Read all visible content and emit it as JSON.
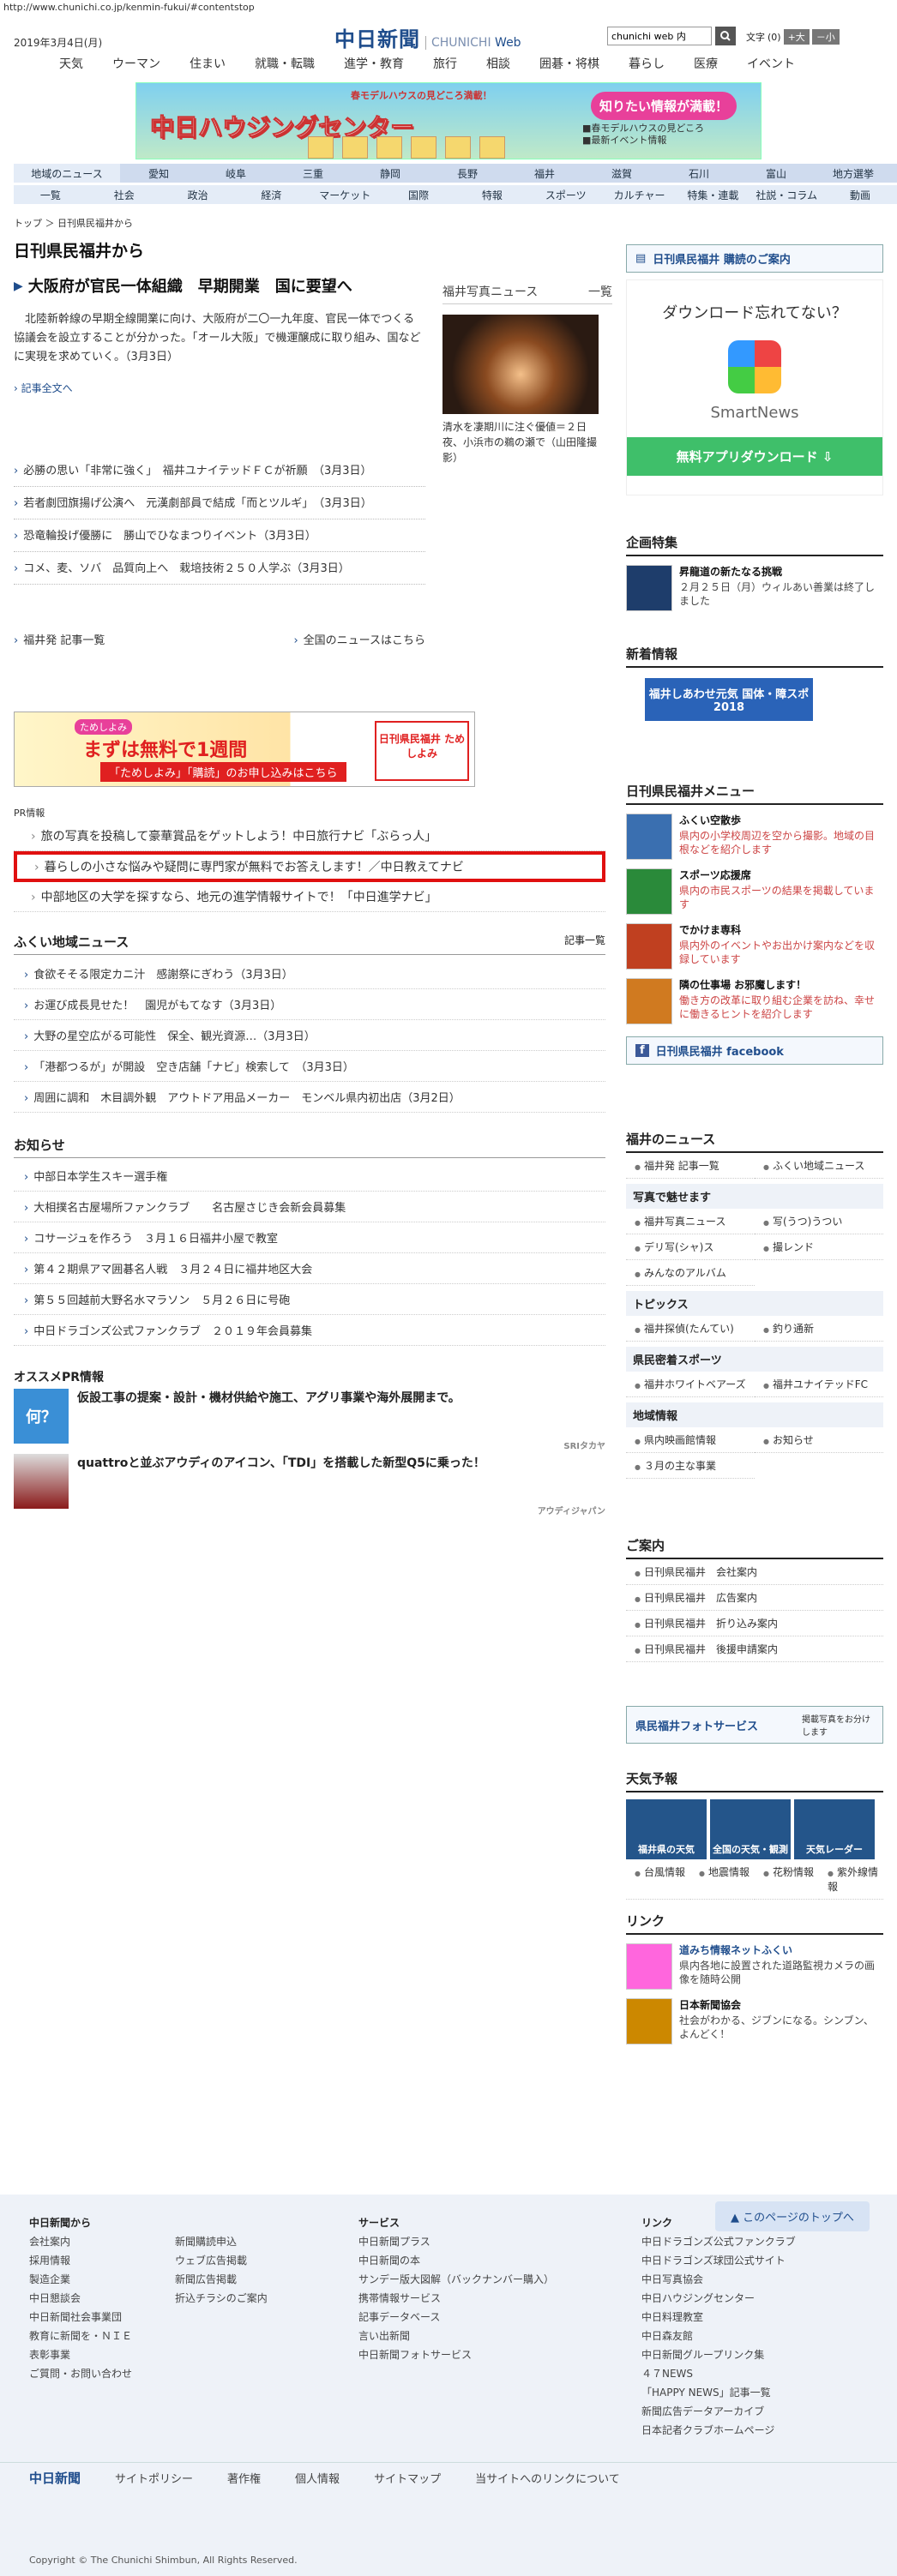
{
  "url": "http://www.chunichi.co.jp/kenmin-fukui/#contentstop",
  "date": "2019年3月4日(月)",
  "logo": {
    "ja": "中日新聞",
    "en1": "CHUNICHI",
    "en2": "Web"
  },
  "search": {
    "value": "chunichi web 内"
  },
  "font": {
    "label": "文字",
    "size": "(0)",
    "plus": "+大",
    "minus": "－小"
  },
  "gnav": [
    "天気",
    "ウーマン",
    "住まい",
    "就職・転職",
    "進学・教育",
    "旅行",
    "相談",
    "囲碁・将棋",
    "暮らし",
    "医療",
    "イベント"
  ],
  "banner": {
    "t1": "春モデルハウスの見どころ満載！",
    "t2": "中日ハウジングセンター",
    "t3": "知りたい情報が満載！",
    "t4": "■春モデルハウスの見どころ\n■最新イベント情報"
  },
  "area": [
    "地域のニュース",
    "愛知",
    "岐阜",
    "三重",
    "静岡",
    "長野",
    "福井",
    "滋賀",
    "石川",
    "富山",
    "地方選挙"
  ],
  "cats": [
    "一覧",
    "社会",
    "政治",
    "経済",
    "マーケット",
    "国際",
    "特報",
    "スポーツ",
    "カルチャー",
    "特集・連載",
    "社説・コラム",
    "動画"
  ],
  "breadcrumb": "トップ ＞ 日刊県民福井から",
  "page_title": "日刊県民福井から",
  "lead": {
    "headline": "大阪府が官民一体組織　早期開業　国に要望へ",
    "body": "北陸新幹線の早期全線開業に向け、大阪府が二〇一九年度、官民一体でつくる協議会を設立することが分かった。「オール大阪」で機運醸成に取り組み、国などに実現を求めていく。（3月3日）",
    "more": "記事全文へ"
  },
  "photo": {
    "head": "福井写真ニュース",
    "list": "一覧",
    "caption": "清水を凄期川に注ぐ優値＝２日夜、小浜市の鵜の瀬で（山田隆撮影）"
  },
  "news": [
    "必勝の思い「非常に強く」　福井ユナイテッドＦＣが祈願　（3月3日）",
    "若者劇団旗揚げ公演へ　元漢劇部員で結成「而とツルギ」　（3月3日）",
    "恐竜輪投げ優勝に　勝山でひなまつりイベント（3月3日）",
    "コメ、麦、ソバ　品質向上へ　栽培技術２５０人学ぶ（3月3日）"
  ],
  "foot": {
    "left": "福井発 記事一覧",
    "right": "全国のニュースはこちら"
  },
  "promo": {
    "a": "ためしよみ",
    "b": "まずは無料で1週間",
    "c": "「ためしよみ」「購読」のお申し込みはこちら",
    "d": "日刊県民福井 ためしよみ"
  },
  "pr": {
    "head": "PR情報",
    "items": [
      "旅の写真を投稿して豪華賞品をゲットしよう！中日旅行ナビ「ぶらっ人」",
      "暮らしの小さな悩みや疑問に専門家が無料でお答えします！／中日教えてナビ",
      "中部地区の大学を探すなら、地元の進学情報サイトで！「中日進学ナビ」"
    ]
  },
  "fukui": {
    "head": "ふくい地域ニュース",
    "more": "記事一覧",
    "items": [
      "食欲そそる限定カニ汁　感謝祭にぎわう（3月3日）",
      "お運び成長見せた！　園児がもてなす（3月3日）",
      "大野の星空広がる可能性　保全、観光資源…（3月3日）",
      "「港都つるが」が開設　空き店舗「ナビ」検索して　（3月3日）",
      "周囲に調和　木目調外観　アウトドア用品メーカー　モンベル県内初出店（3月2日）"
    ]
  },
  "notice": {
    "head": "お知らせ",
    "items": [
      "中部日本学生スキー選手権",
      "大相撲名古屋場所ファンクラブ　　名古屋さじき会新会員募集",
      "コサージュを作ろう　３月１６日福井小屋で教室",
      "第４２期県アマ囲碁名人戦　３月２４日に福井地区大会",
      "第５５回越前大野名水マラソン　５月２６日に号砲",
      "中日ドラゴンズ公式ファンクラブ　２０１９年会員募集"
    ]
  },
  "osusume": {
    "head": "オススメPR情報",
    "i1": "仮設工事の提案・設計・機材供給や施工、アグリ事業や海外展開まで。",
    "s1": "SRIタカヤ",
    "i2": "quattroと並ぶアウディのアイコン、「TDI」を搭載した新型Q5に乗った！",
    "s2": "アウディジャパン",
    "t1": "何？"
  },
  "right": {
    "subscribe": "日刊県民福井 購読のご案内",
    "ad": {
      "q": "ダウンロード忘れてない？",
      "name": "SmartNews",
      "dl": "無料アプリダウンロード"
    },
    "kikaku": {
      "head": "企画特集",
      "title": "昇龍道の新たなる挑戦",
      "text": "２月２５日（月）ウィルあい善業は終了しました"
    },
    "shinchaku": {
      "head": "新着情報",
      "banner": "福井しあわせ元気 国体・障スポ 2018"
    },
    "menu": {
      "head": "日刊県民福井メニュー",
      "items": [
        {
          "t": "ふくい空散歩",
          "d": "県内の小学校周辺を空から撮影。地域の目根などを紹介します"
        },
        {
          "t": "スポーツ応援席",
          "d": "県内の市民スポーツの結果を掲載しています"
        },
        {
          "t": "でかけま専科",
          "d": "県内外のイベントやお出かけ案内などを収録しています"
        },
        {
          "t": "隣の仕事場 お邪魔します！",
          "d": "働き方の改革に取り組む企業を訪ね、幸せに働きるヒントを紹介します"
        }
      ],
      "fb": "日刊県民福井 facebook"
    },
    "fnews": {
      "head": "福井のニュース",
      "g1": [
        "福井発 記事一覧",
        "ふくい地域ニュース"
      ],
      "photo": "写真で魅せます",
      "g2": [
        "福井写真ニュース",
        "写(うつ)うつい",
        "デリ写(シャ)ス",
        "撮レンド",
        "みんなのアルバム"
      ],
      "topics": "トピックス",
      "g3": [
        "福井探偵(たんてい)",
        "釣り通新"
      ],
      "sports": "県民密着スポーツ",
      "g4": [
        "福井ホワイトベアーズ",
        "福井ユナイテッドFC"
      ],
      "local": "地域情報",
      "g5": [
        "県内映画館情報",
        "お知らせ",
        "３月の主な事業"
      ]
    },
    "annai": {
      "head": "ご案内",
      "items": [
        "日刊県民福井　会社案内",
        "日刊県民福井　広告案内",
        "日刊県民福井　折り込み案内",
        "日刊県民福井　後援申請案内"
      ]
    },
    "photoservice": "県民福井フォトサービス",
    "psnote": "掲載写真をお分けします",
    "weather": {
      "head": "天気予報",
      "w": [
        "福井県の天気",
        "全国の天気・観測",
        "天気レーダー"
      ],
      "items": [
        "台風情報",
        "地震情報",
        "花粉情報",
        "紫外線情報"
      ]
    },
    "link": {
      "head": "リンク",
      "l1": "道みち情報ネットふくい",
      "l1d": "県内各地に設置された道路監視カメラの画像を随時公開",
      "l2": "日本新聞協会",
      "l2d": "社会がわかる、ジブンになる。シンブン、よんどく！"
    }
  },
  "totop": "このページのトップへ",
  "footer": {
    "c1h": "中日新聞から",
    "c1": [
      "会社案内",
      "採用情報",
      "製造企業",
      "中日懇談会",
      "中日新聞社会事業団",
      "教育に新聞を・ＮＩＥ",
      "表彰事業",
      "ご質問・お問い合わせ"
    ],
    "c2": [
      "新聞購読申込",
      "ウェブ広告掲載",
      "新聞広告掲載",
      "折込チラシのご案内"
    ],
    "c3h": "サービス",
    "c3": [
      "中日新聞プラス",
      "中日新聞の本",
      "サンデー版大図解（バックナンバー購入）",
      "携帯情報サービス",
      "記事データベース",
      "言い出新聞",
      "中日新聞フォトサービス"
    ],
    "c4h": "リンク",
    "c4": [
      "中日ドラゴンズ公式ファンクラブ",
      "中日ドラゴンズ球団公式サイト",
      "中日写真協会",
      "中日ハウジングセンター",
      "中日料理教室",
      "中日森友館",
      "中日新聞グループリンク集",
      "４７NEWS",
      "「HAPPY NEWS」記事一覧",
      "新聞広告データアーカイブ",
      "日本記者クラブホームページ"
    ]
  },
  "bar": [
    "中日新聞",
    "サイトポリシー",
    "著作権",
    "個人情報",
    "サイトマップ",
    "当サイトへのリンクについて"
  ],
  "copyright": "Copyright © The Chunichi Shimbun, All Rights Reserved."
}
